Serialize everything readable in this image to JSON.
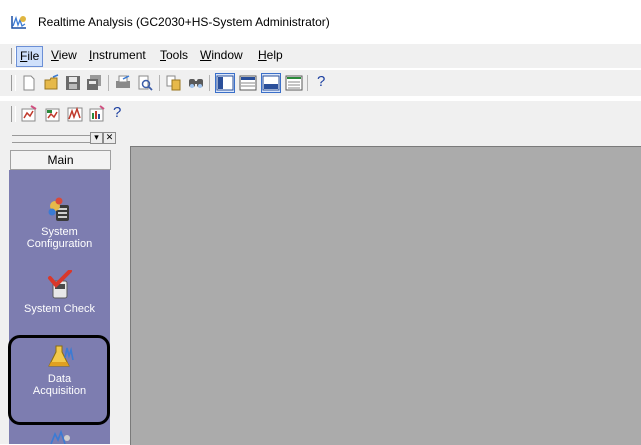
{
  "window": {
    "title": "Realtime Analysis (GC2030+HS-System Administrator)"
  },
  "menu": {
    "items": [
      "File",
      "View",
      "Instrument",
      "Tools",
      "Window",
      "Help"
    ]
  },
  "toolbar1": {
    "help_label": "?"
  },
  "toolbar2": {
    "help_label": "?"
  },
  "sidebar": {
    "header_buttons": [
      "▾",
      "✕"
    ],
    "tab_label": "Main",
    "items": [
      {
        "label": "System Configuration",
        "line1": "System",
        "line2": "Configuration"
      },
      {
        "label": "System Check"
      },
      {
        "label": "Data Acquisition",
        "line1": "Data",
        "line2": "Acquisition"
      }
    ]
  },
  "colors": {
    "nav_panel": "#7d7db0",
    "workspace": "#ababab",
    "menu_highlight": "#cfe0fb"
  }
}
